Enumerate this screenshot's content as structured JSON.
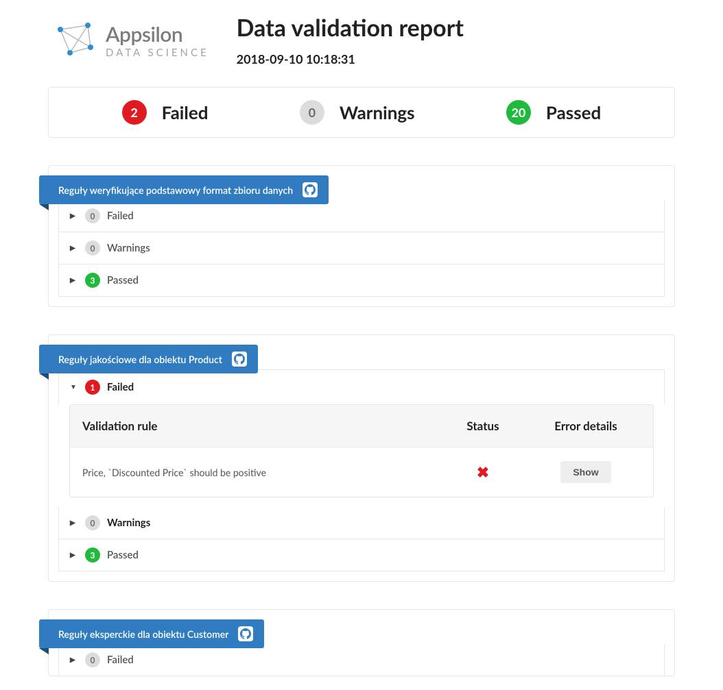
{
  "brand": {
    "name": "Appsilon",
    "sub": "DATA SCIENCE"
  },
  "report": {
    "title": "Data validation report",
    "timestamp": "2018-09-10 10:18:31"
  },
  "summary": {
    "failed": {
      "count": "2",
      "label": "Failed"
    },
    "warnings": {
      "count": "0",
      "label": "Warnings"
    },
    "passed": {
      "count": "20",
      "label": "Passed"
    }
  },
  "sections": [
    {
      "title": "Reguły weryfikujące podstawowy format zbioru danych",
      "failed": {
        "count": "0",
        "label": "Failed"
      },
      "warnings": {
        "count": "0",
        "label": "Warnings"
      },
      "passed": {
        "count": "3",
        "label": "Passed"
      }
    },
    {
      "title": "Reguły jakościowe dla obiektu Product",
      "failed": {
        "count": "1",
        "label": "Failed"
      },
      "warnings": {
        "count": "0",
        "label": "Warnings"
      },
      "passed": {
        "count": "3",
        "label": "Passed"
      },
      "table": {
        "headers": {
          "rule": "Validation rule",
          "status": "Status",
          "details": "Error details"
        },
        "row": {
          "rule": "Price, `Discounted Price` should be positive",
          "show": "Show"
        }
      }
    },
    {
      "title": "Reguły eksperckie dla obiektu Customer",
      "failed": {
        "count": "0",
        "label": "Failed"
      }
    }
  ]
}
